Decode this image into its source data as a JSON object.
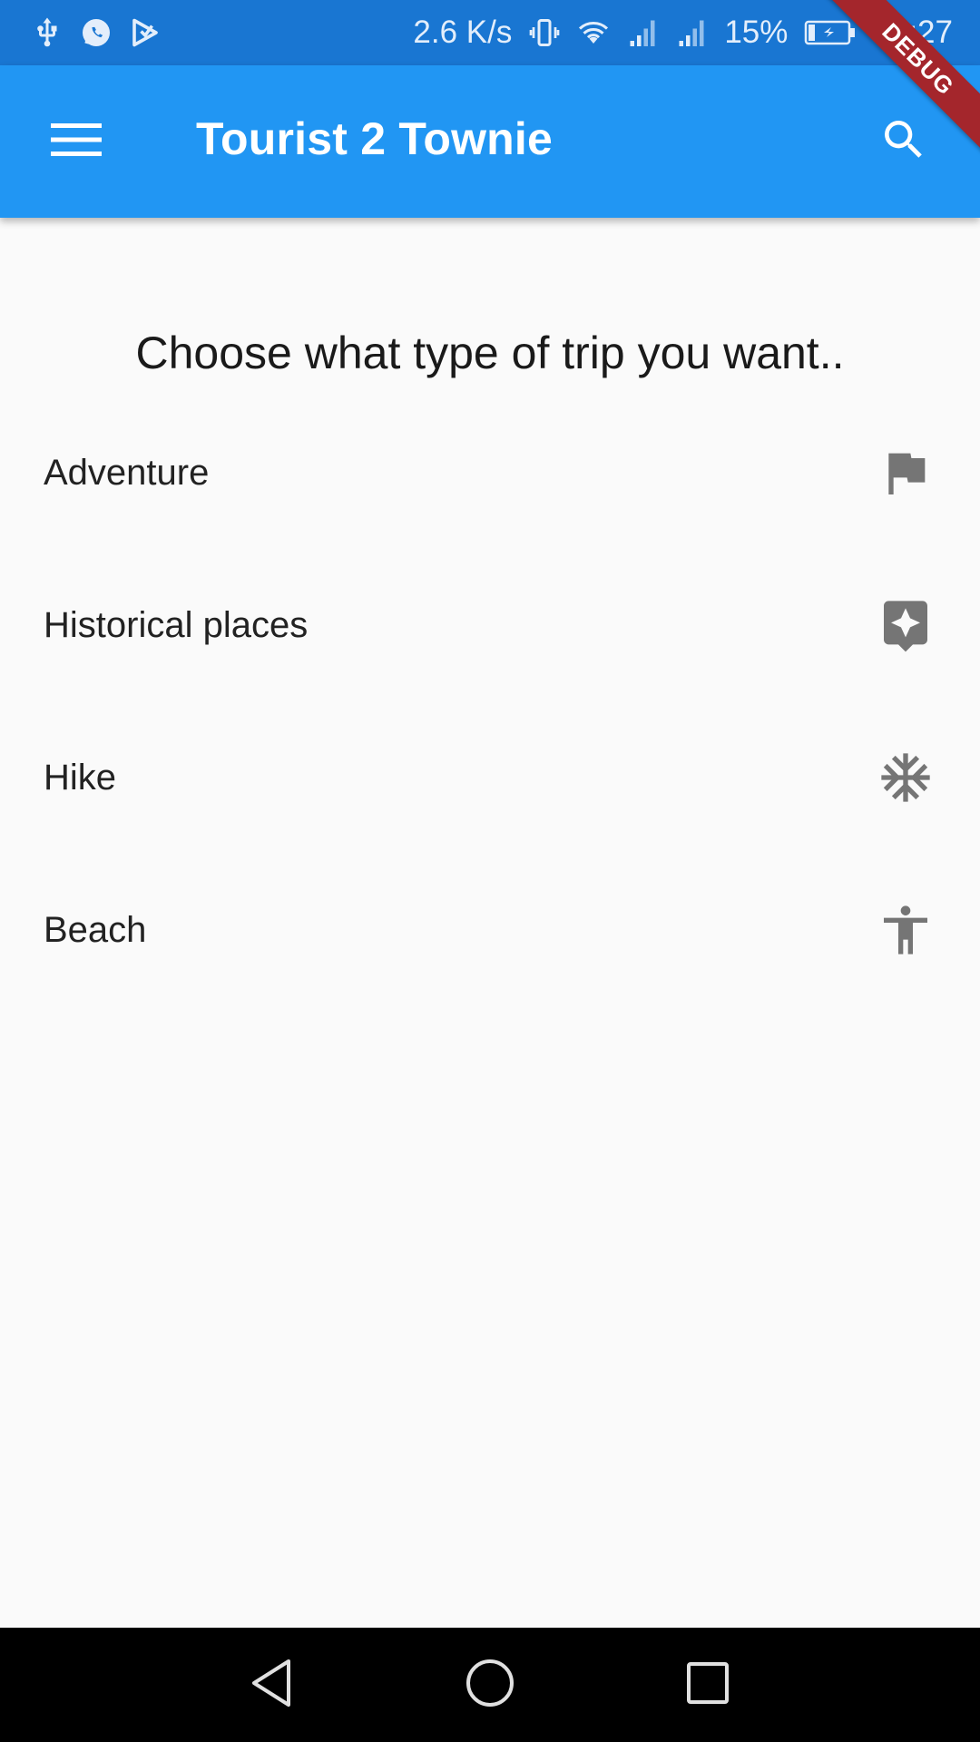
{
  "status_bar": {
    "speed": "2.6 K/s",
    "battery_percent": "15%",
    "time": "00:27",
    "icons": [
      "usb-icon",
      "whatsapp-icon",
      "play-store-icon",
      "vibrate-icon",
      "wifi-icon",
      "signal-icon",
      "signal-icon",
      "battery-charging-icon"
    ]
  },
  "app_bar": {
    "title": "Tourist 2 Townie",
    "menu_icon": "menu-icon",
    "search_icon": "search-icon"
  },
  "debug_banner": {
    "label": "DEBUG"
  },
  "content": {
    "prompt": "Choose what type of trip you want..",
    "trip_types": [
      {
        "label": "Adventure",
        "icon": "flag-icon"
      },
      {
        "label": "Historical places",
        "icon": "local-see-star-icon"
      },
      {
        "label": "Hike",
        "icon": "snowflake-icon"
      },
      {
        "label": "Beach",
        "icon": "accessibility-icon"
      }
    ]
  },
  "colors": {
    "status_bar": "#1976d2",
    "app_bar": "#2196f3",
    "background": "#fafafa",
    "icon_grey": "#757575",
    "debug_ribbon": "#a4262c"
  }
}
